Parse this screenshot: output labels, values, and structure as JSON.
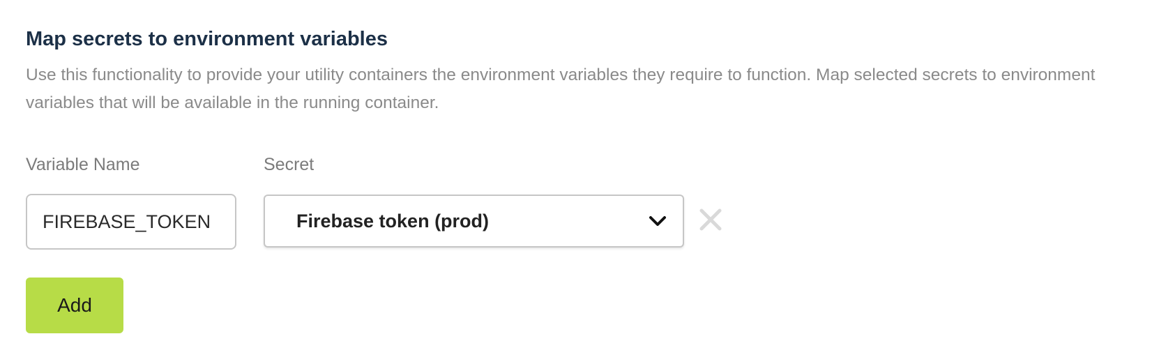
{
  "section": {
    "title": "Map secrets to environment variables",
    "description": "Use this functionality to provide your utility containers the environment variables they require to function. Map selected secrets to environment variables that will be available in the running container."
  },
  "mapping": {
    "variable_label": "Variable Name",
    "secret_label": "Secret",
    "rows": [
      {
        "variable_value": "FIREBASE_TOKEN",
        "secret_value": "Firebase token (prod)"
      }
    ]
  },
  "icons": {
    "select_arrow": "chevron-down-icon",
    "remove": "close-icon"
  },
  "actions": {
    "add_label": "Add"
  },
  "colors": {
    "title": "#1c3047",
    "description": "#8a8a8a",
    "label": "#7b7b7b",
    "add_button": "#b7dc47",
    "remove_icon": "#d9d9d9"
  }
}
